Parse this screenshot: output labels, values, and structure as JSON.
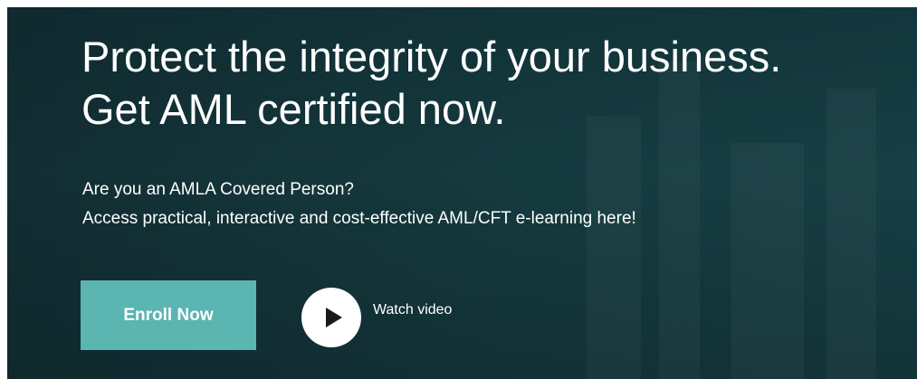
{
  "hero": {
    "headline_line1": "Protect the integrity of your business.",
    "headline_line2": "Get AML certified now.",
    "subtext_line1": "Are you an AMLA Covered Person?",
    "subtext_line2": "Access practical, interactive and cost-effective AML/CFT e-learning here!",
    "enroll_label": "Enroll Now",
    "watch_label": "Watch video",
    "play_icon": "play-icon",
    "colors": {
      "background": "#163f44",
      "accent": "#5bb5b1",
      "text": "#ffffff"
    }
  }
}
